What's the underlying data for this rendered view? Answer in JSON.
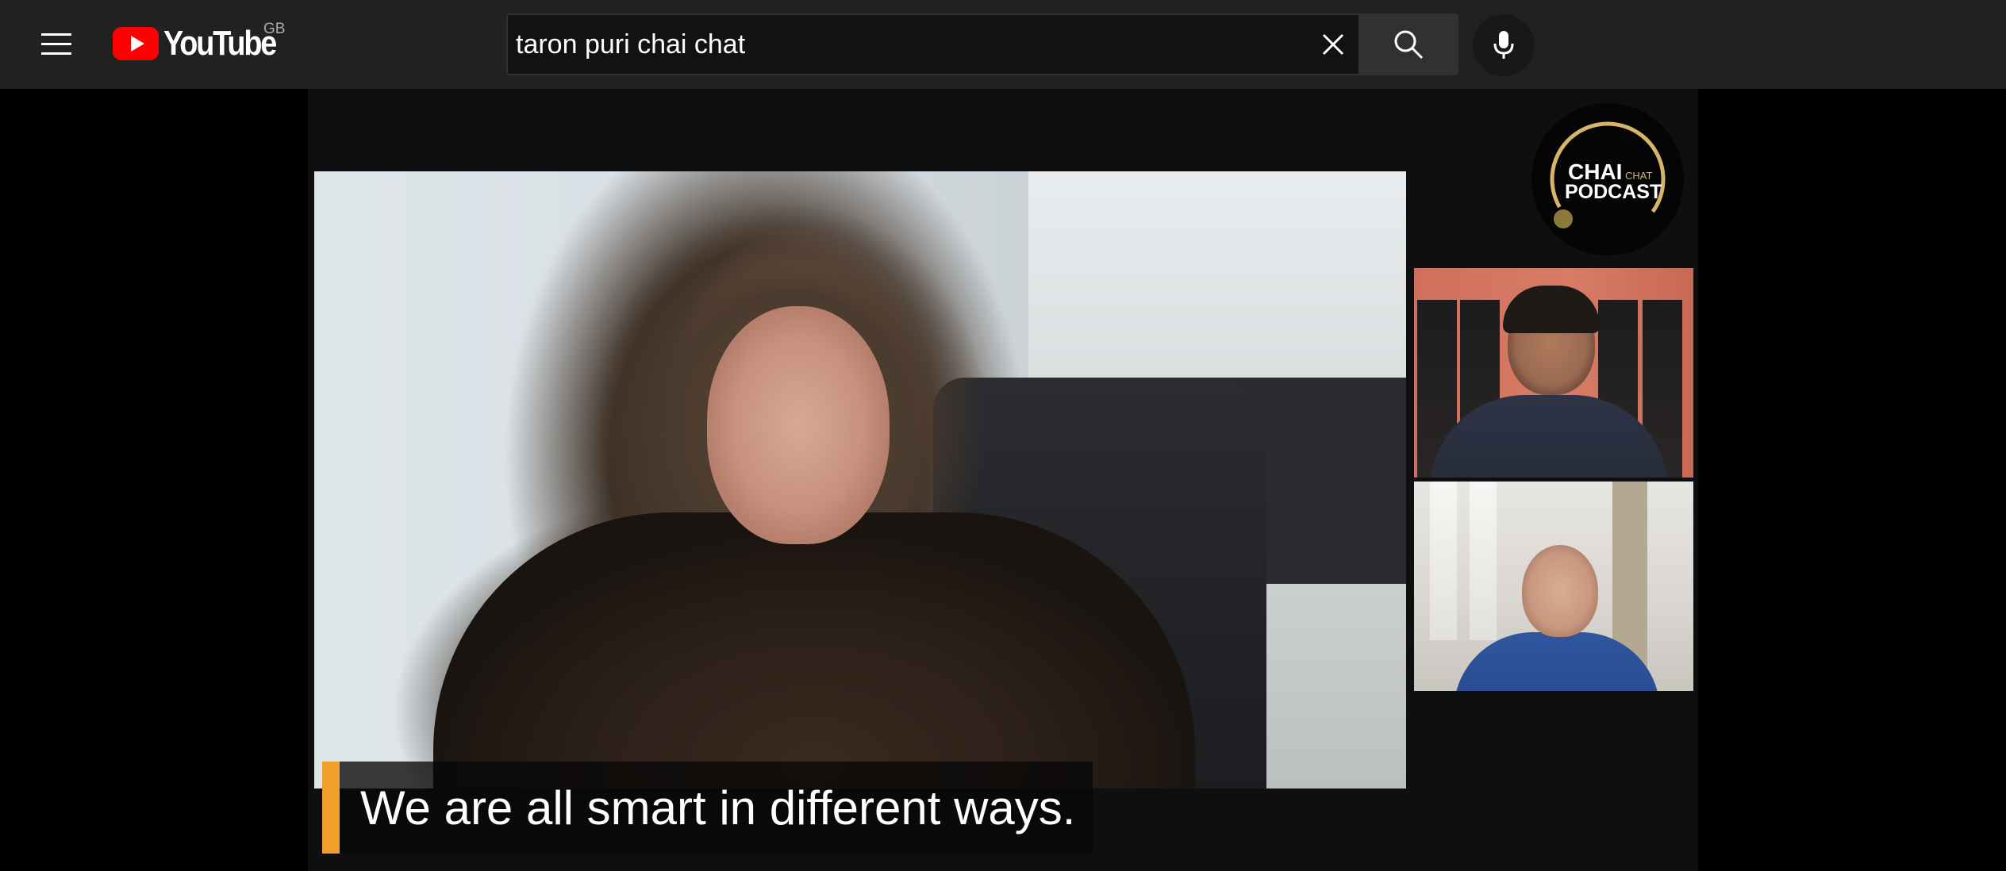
{
  "header": {
    "logo_text": "YouTube",
    "country_code": "GB",
    "search": {
      "value": "taron puri chai chat",
      "placeholder": "Search"
    }
  },
  "icons": {
    "menu": "menu-icon",
    "logo": "youtube-play-icon",
    "clear": "close-icon",
    "search": "search-icon",
    "mic": "mic-icon"
  },
  "player": {
    "caption": "We are all smart in different ways.",
    "podcast_logo": {
      "line1": "CHAI",
      "line1_small": "CHAT",
      "line2": "PODCAST"
    }
  },
  "colors": {
    "masthead_bg": "#212121",
    "brand_red": "#ff0000",
    "caption_accent": "#f0a02a",
    "podcast_gold": "#c9a45c"
  }
}
